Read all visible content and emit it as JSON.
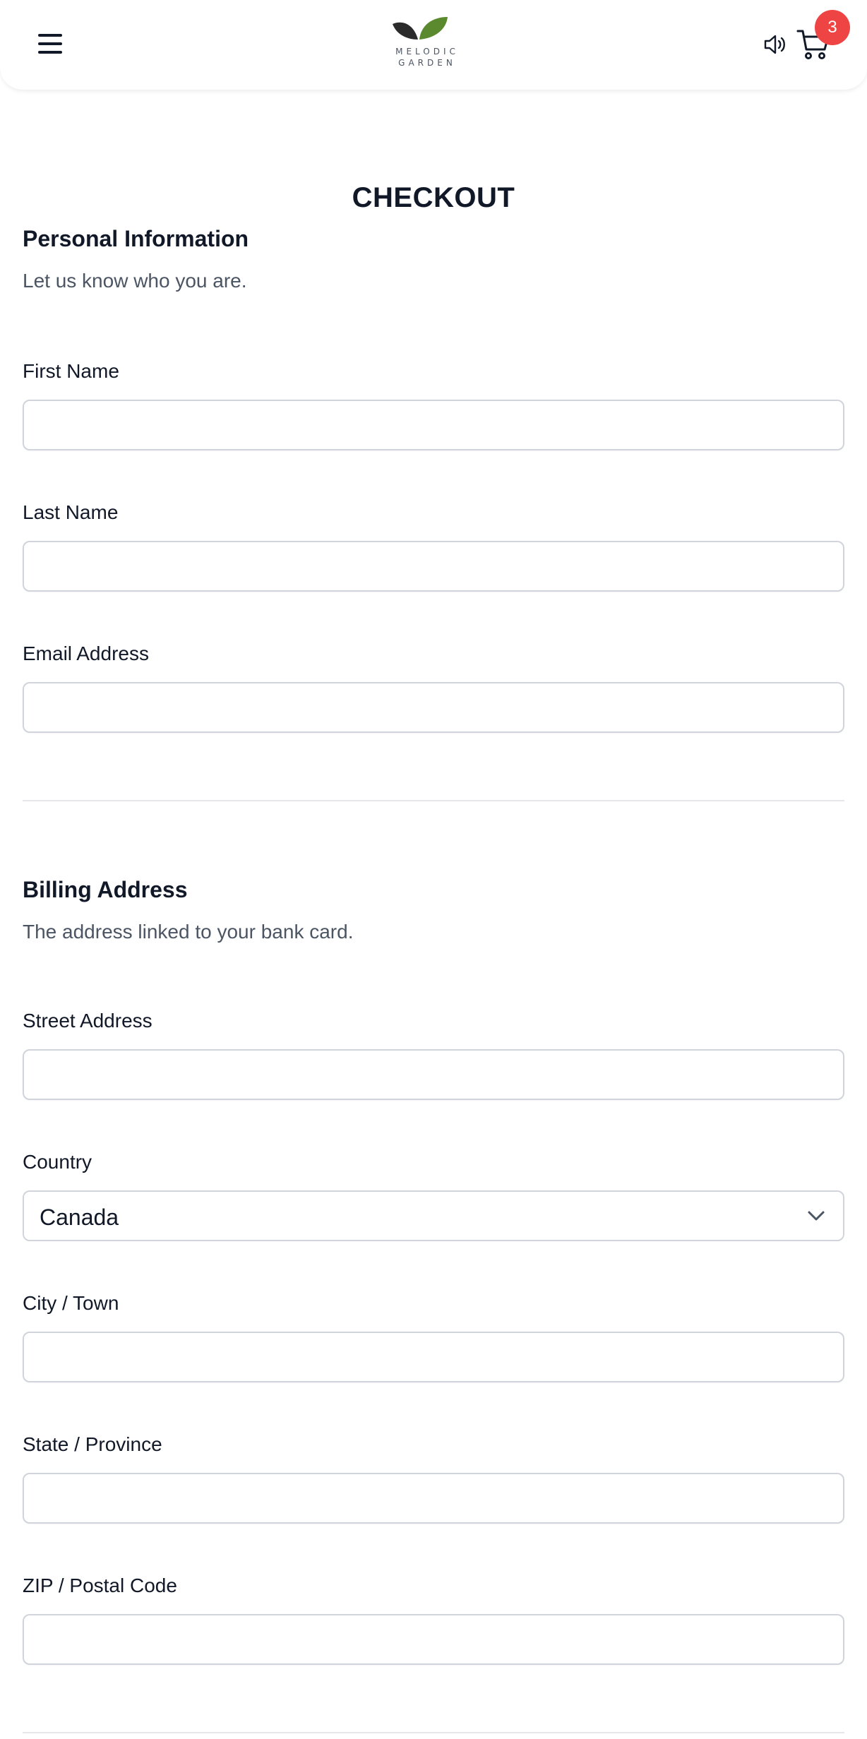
{
  "header": {
    "logo_line1": "MELODIC",
    "logo_line2": "GARDEN",
    "cart_count": "3",
    "icons": {
      "menu": "hamburger-menu-icon",
      "sound": "speaker-icon",
      "cart": "shopping-cart-icon",
      "logo": "leaf-logo-icon"
    }
  },
  "checkout": {
    "title": "CHECKOUT"
  },
  "personal": {
    "title": "Personal Information",
    "description": "Let us know who you are.",
    "first_name_label": "First Name",
    "first_name_value": "",
    "last_name_label": "Last Name",
    "last_name_value": "",
    "email_label": "Email Address",
    "email_value": ""
  },
  "billing": {
    "title": "Billing Address",
    "description": "The address linked to your bank card.",
    "street_label": "Street Address",
    "street_value": "",
    "country_label": "Country",
    "country_value": "Canada",
    "city_label": "City / Town",
    "city_value": "",
    "state_label": "State / Province",
    "state_value": "",
    "zip_label": "ZIP / Postal Code",
    "zip_value": ""
  },
  "colors": {
    "badge": "#ef4444",
    "leaf_dark": "#2b2b2b",
    "leaf_green": "#5b8a2e",
    "border": "#d1d5db",
    "text": "#111827",
    "muted": "#4b5563"
  }
}
